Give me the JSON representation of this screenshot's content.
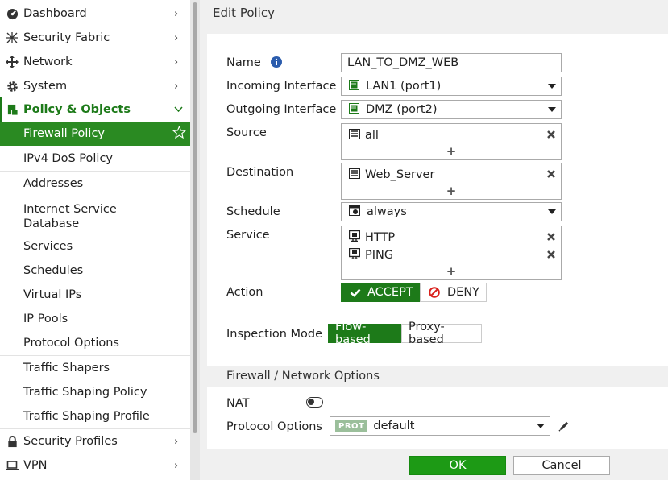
{
  "sidebar": {
    "items": [
      {
        "label": "Dashboard",
        "icon": "dashboard-icon"
      },
      {
        "label": "Security Fabric",
        "icon": "fabric-icon"
      },
      {
        "label": "Network",
        "icon": "network-icon"
      },
      {
        "label": "System",
        "icon": "gear-icon"
      },
      {
        "label": "Policy & Objects",
        "icon": "policy-icon"
      }
    ],
    "sub_items": [
      {
        "label": "Firewall Policy"
      },
      {
        "label": "IPv4 DoS Policy"
      },
      {
        "label": "Addresses"
      },
      {
        "label": "Internet Service Database"
      },
      {
        "label": "Services"
      },
      {
        "label": "Schedules"
      },
      {
        "label": "Virtual IPs"
      },
      {
        "label": "IP Pools"
      },
      {
        "label": "Protocol Options"
      },
      {
        "label": "Traffic Shapers"
      },
      {
        "label": "Traffic Shaping Policy"
      },
      {
        "label": "Traffic Shaping Profile"
      }
    ],
    "bottom_items": [
      {
        "label": "Security Profiles",
        "icon": "lock-icon"
      },
      {
        "label": "VPN",
        "icon": "laptop-icon"
      }
    ]
  },
  "page": {
    "title": "Edit Policy"
  },
  "form": {
    "name_label": "Name",
    "name_value": "LAN_TO_DMZ_WEB",
    "incoming_label": "Incoming Interface",
    "incoming_value": "LAN1 (port1)",
    "outgoing_label": "Outgoing Interface",
    "outgoing_value": "DMZ (port2)",
    "source_label": "Source",
    "source_entries": [
      "all"
    ],
    "destination_label": "Destination",
    "destination_entries": [
      "Web_Server"
    ],
    "schedule_label": "Schedule",
    "schedule_value": "always",
    "service_label": "Service",
    "service_entries": [
      "HTTP",
      "PING"
    ],
    "add_symbol": "+",
    "action_label": "Action",
    "action_accept": "ACCEPT",
    "action_deny": "DENY",
    "action_selected": "ACCEPT",
    "inspection_label": "Inspection Mode",
    "inspection_flow": "Flow-based",
    "inspection_proxy": "Proxy-based",
    "inspection_selected": "Flow-based",
    "section_title": "Firewall / Network Options",
    "nat_label": "NAT",
    "nat_enabled": false,
    "protocol_label": "Protocol Options",
    "protocol_badge": "PROT",
    "protocol_value": "default"
  },
  "footer": {
    "ok_label": "OK",
    "cancel_label": "Cancel"
  },
  "colors": {
    "accent": "#1d7a19",
    "active_bg": "#2a8a22",
    "ok_bg": "#1d9a15",
    "deny_red": "#d9211c"
  }
}
